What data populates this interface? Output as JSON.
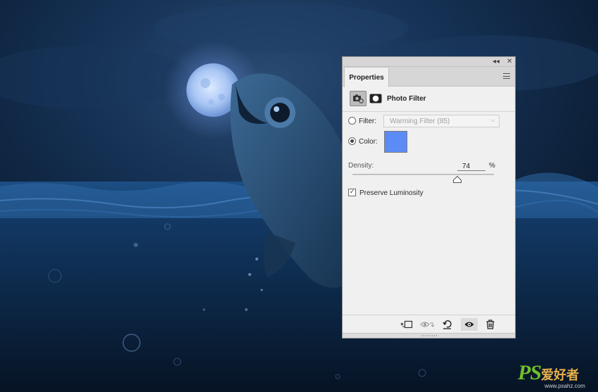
{
  "panel": {
    "collapse_glyph": "◂◂",
    "close_glyph": "✕",
    "tab_label": "Properties",
    "menu_icon": "hamburger-menu-icon",
    "adjustment_icon": "camera-icon",
    "mask_icon": "layer-mask-icon",
    "title": "Photo Filter",
    "filter_label": "Filter:",
    "filter_value": "Warming Filter (85)",
    "filter_selected": false,
    "color_label": "Color:",
    "color_selected": true,
    "color_value": "#5b8cf5",
    "density_label": "Density:",
    "density_value": "74",
    "density_unit": "%",
    "density_fraction": 0.74,
    "preserve_luminosity_label": "Preserve Luminosity",
    "preserve_luminosity_checked": true,
    "bottom_buttons": [
      {
        "name": "clip-to-layer-icon"
      },
      {
        "name": "view-previous-state-icon"
      },
      {
        "name": "reset-icon"
      },
      {
        "name": "toggle-visibility-icon"
      },
      {
        "name": "delete-icon"
      }
    ]
  },
  "watermark": {
    "brand": "PS",
    "chinese": "爱好者",
    "url": "www.psahz.com"
  },
  "colors": {
    "panel_bg": "#f0f0f0",
    "accent_swatch": "#5b8cf5",
    "scene_bg": "#0b1a2c"
  }
}
